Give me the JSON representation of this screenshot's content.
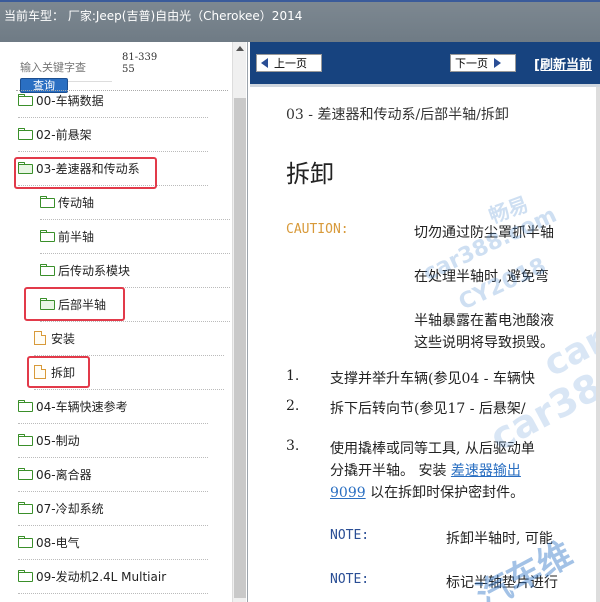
{
  "title_bar": {
    "text": "当前车型： 厂家:Jeep(吉普)自由光（Cherokee）2014"
  },
  "search": {
    "placeholder": "输入关键字查",
    "button_label": "查询",
    "count": "81-33955"
  },
  "tree": {
    "items": [
      {
        "label": "00-车辆数据",
        "type": "folder",
        "level": 0
      },
      {
        "label": "02-前悬架",
        "type": "folder",
        "level": 0
      },
      {
        "label": "03-差速器和传动系",
        "type": "folder-open",
        "level": 0
      },
      {
        "label": "传动轴",
        "type": "folder",
        "level": 1
      },
      {
        "label": "前半轴",
        "type": "folder",
        "level": 1
      },
      {
        "label": "后传动系模块",
        "type": "folder",
        "level": 1
      },
      {
        "label": "后部半轴",
        "type": "folder-open",
        "level": 1
      },
      {
        "label": "安装",
        "type": "doc",
        "level": 2
      },
      {
        "label": "拆卸",
        "type": "doc",
        "level": 2
      },
      {
        "label": "04-车辆快速参考",
        "type": "folder",
        "level": 0
      },
      {
        "label": "05-制动",
        "type": "folder",
        "level": 0
      },
      {
        "label": "06-离合器",
        "type": "folder",
        "level": 0
      },
      {
        "label": "07-冷却系统",
        "type": "folder",
        "level": 0
      },
      {
        "label": "08-电气",
        "type": "folder",
        "level": 0
      },
      {
        "label": "09-发动机2.4L Multiair",
        "type": "folder",
        "level": 0
      }
    ]
  },
  "nav": {
    "prev_label": "上一页",
    "next_label": "下一页",
    "refresh_label": "[刷新当前"
  },
  "document": {
    "path": "03 - 差速器和传动系/后部半轴/拆卸",
    "heading": "拆卸",
    "caution_label": "CAUTION:",
    "caution_lines": [
      "切勿通过防尘罩抓半轴",
      "在处理半轴时, 避免弯",
      "半轴暴露在蓄电池酸液",
      "这些说明将导致损毁。"
    ],
    "steps": [
      {
        "num": "1.",
        "text": "支撑并举升车辆(参见04 - 车辆快"
      },
      {
        "num": "2.",
        "text": "拆下后转向节(参见17 - 后悬架/"
      },
      {
        "num": "3.",
        "text_a": "使用撬棒或同等工具, 从后驱动单",
        "text_b": "分撬开半轴。 安装 ",
        "link": "差速器输出",
        "text_c": "9099",
        "text_d": " 以在拆卸时保护密封件。"
      }
    ],
    "notes": [
      {
        "label": "NOTE:",
        "text": "拆卸半轴时, 可能"
      },
      {
        "label": "NOTE:",
        "text": "标记半轴垫片进行"
      }
    ]
  },
  "watermarks": [
    "畅易",
    "car388.com",
    "CY2018",
    "car38",
    "car38",
    "汽车维"
  ]
}
